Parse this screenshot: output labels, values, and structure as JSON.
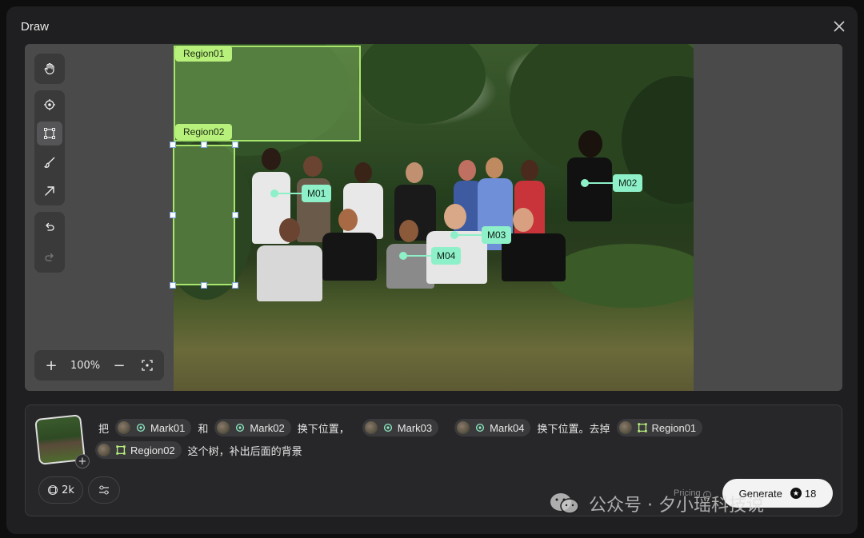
{
  "dialog": {
    "title": "Draw"
  },
  "canvas": {
    "zoom_label": "100%",
    "regions": [
      {
        "label": "Region01"
      },
      {
        "label": "Region02"
      }
    ],
    "marks": [
      {
        "label": "M01"
      },
      {
        "label": "M02"
      },
      {
        "label": "M03"
      },
      {
        "label": "M04"
      }
    ]
  },
  "toolbar": {
    "tools": [
      "hand-icon",
      "target-icon",
      "rectangle-select-icon",
      "brush-icon",
      "arrow-icon"
    ],
    "history": [
      "undo-icon",
      "redo-icon"
    ]
  },
  "prompt": {
    "t1": "把",
    "chip_mark01": "Mark01",
    "t2": "和",
    "chip_mark02": "Mark02",
    "t3": "换下位置，",
    "chip_mark03": "Mark03",
    "chip_mark04": "Mark04",
    "t4": "换下位置。去掉",
    "chip_region01": "Region01",
    "chip_region02": "Region02",
    "t5": "这个树，补出后面的背景"
  },
  "controls": {
    "resolution": "2k",
    "pricing_label": "Pricing",
    "generate_label": "Generate",
    "credits": "18"
  },
  "watermark": {
    "text": "公众号 · 夕小瑶科技说"
  },
  "colors": {
    "region": "#b8f07c",
    "mark": "#8ef0c8",
    "panel": "#1f1f21"
  }
}
